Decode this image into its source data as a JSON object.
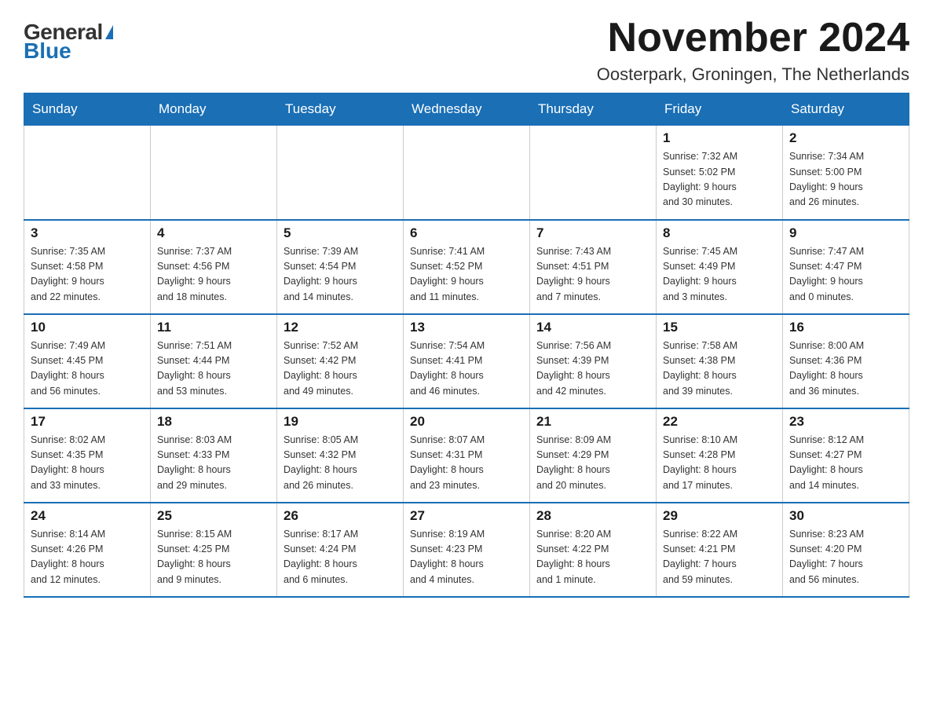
{
  "logo": {
    "general": "General",
    "blue": "Blue",
    "alt": "GeneralBlue logo"
  },
  "title": "November 2024",
  "location": "Oosterpark, Groningen, The Netherlands",
  "days_of_week": [
    "Sunday",
    "Monday",
    "Tuesday",
    "Wednesday",
    "Thursday",
    "Friday",
    "Saturday"
  ],
  "weeks": [
    [
      {
        "day": "",
        "info": ""
      },
      {
        "day": "",
        "info": ""
      },
      {
        "day": "",
        "info": ""
      },
      {
        "day": "",
        "info": ""
      },
      {
        "day": "",
        "info": ""
      },
      {
        "day": "1",
        "info": "Sunrise: 7:32 AM\nSunset: 5:02 PM\nDaylight: 9 hours\nand 30 minutes."
      },
      {
        "day": "2",
        "info": "Sunrise: 7:34 AM\nSunset: 5:00 PM\nDaylight: 9 hours\nand 26 minutes."
      }
    ],
    [
      {
        "day": "3",
        "info": "Sunrise: 7:35 AM\nSunset: 4:58 PM\nDaylight: 9 hours\nand 22 minutes."
      },
      {
        "day": "4",
        "info": "Sunrise: 7:37 AM\nSunset: 4:56 PM\nDaylight: 9 hours\nand 18 minutes."
      },
      {
        "day": "5",
        "info": "Sunrise: 7:39 AM\nSunset: 4:54 PM\nDaylight: 9 hours\nand 14 minutes."
      },
      {
        "day": "6",
        "info": "Sunrise: 7:41 AM\nSunset: 4:52 PM\nDaylight: 9 hours\nand 11 minutes."
      },
      {
        "day": "7",
        "info": "Sunrise: 7:43 AM\nSunset: 4:51 PM\nDaylight: 9 hours\nand 7 minutes."
      },
      {
        "day": "8",
        "info": "Sunrise: 7:45 AM\nSunset: 4:49 PM\nDaylight: 9 hours\nand 3 minutes."
      },
      {
        "day": "9",
        "info": "Sunrise: 7:47 AM\nSunset: 4:47 PM\nDaylight: 9 hours\nand 0 minutes."
      }
    ],
    [
      {
        "day": "10",
        "info": "Sunrise: 7:49 AM\nSunset: 4:45 PM\nDaylight: 8 hours\nand 56 minutes."
      },
      {
        "day": "11",
        "info": "Sunrise: 7:51 AM\nSunset: 4:44 PM\nDaylight: 8 hours\nand 53 minutes."
      },
      {
        "day": "12",
        "info": "Sunrise: 7:52 AM\nSunset: 4:42 PM\nDaylight: 8 hours\nand 49 minutes."
      },
      {
        "day": "13",
        "info": "Sunrise: 7:54 AM\nSunset: 4:41 PM\nDaylight: 8 hours\nand 46 minutes."
      },
      {
        "day": "14",
        "info": "Sunrise: 7:56 AM\nSunset: 4:39 PM\nDaylight: 8 hours\nand 42 minutes."
      },
      {
        "day": "15",
        "info": "Sunrise: 7:58 AM\nSunset: 4:38 PM\nDaylight: 8 hours\nand 39 minutes."
      },
      {
        "day": "16",
        "info": "Sunrise: 8:00 AM\nSunset: 4:36 PM\nDaylight: 8 hours\nand 36 minutes."
      }
    ],
    [
      {
        "day": "17",
        "info": "Sunrise: 8:02 AM\nSunset: 4:35 PM\nDaylight: 8 hours\nand 33 minutes."
      },
      {
        "day": "18",
        "info": "Sunrise: 8:03 AM\nSunset: 4:33 PM\nDaylight: 8 hours\nand 29 minutes."
      },
      {
        "day": "19",
        "info": "Sunrise: 8:05 AM\nSunset: 4:32 PM\nDaylight: 8 hours\nand 26 minutes."
      },
      {
        "day": "20",
        "info": "Sunrise: 8:07 AM\nSunset: 4:31 PM\nDaylight: 8 hours\nand 23 minutes."
      },
      {
        "day": "21",
        "info": "Sunrise: 8:09 AM\nSunset: 4:29 PM\nDaylight: 8 hours\nand 20 minutes."
      },
      {
        "day": "22",
        "info": "Sunrise: 8:10 AM\nSunset: 4:28 PM\nDaylight: 8 hours\nand 17 minutes."
      },
      {
        "day": "23",
        "info": "Sunrise: 8:12 AM\nSunset: 4:27 PM\nDaylight: 8 hours\nand 14 minutes."
      }
    ],
    [
      {
        "day": "24",
        "info": "Sunrise: 8:14 AM\nSunset: 4:26 PM\nDaylight: 8 hours\nand 12 minutes."
      },
      {
        "day": "25",
        "info": "Sunrise: 8:15 AM\nSunset: 4:25 PM\nDaylight: 8 hours\nand 9 minutes."
      },
      {
        "day": "26",
        "info": "Sunrise: 8:17 AM\nSunset: 4:24 PM\nDaylight: 8 hours\nand 6 minutes."
      },
      {
        "day": "27",
        "info": "Sunrise: 8:19 AM\nSunset: 4:23 PM\nDaylight: 8 hours\nand 4 minutes."
      },
      {
        "day": "28",
        "info": "Sunrise: 8:20 AM\nSunset: 4:22 PM\nDaylight: 8 hours\nand 1 minute."
      },
      {
        "day": "29",
        "info": "Sunrise: 8:22 AM\nSunset: 4:21 PM\nDaylight: 7 hours\nand 59 minutes."
      },
      {
        "day": "30",
        "info": "Sunrise: 8:23 AM\nSunset: 4:20 PM\nDaylight: 7 hours\nand 56 minutes."
      }
    ]
  ]
}
